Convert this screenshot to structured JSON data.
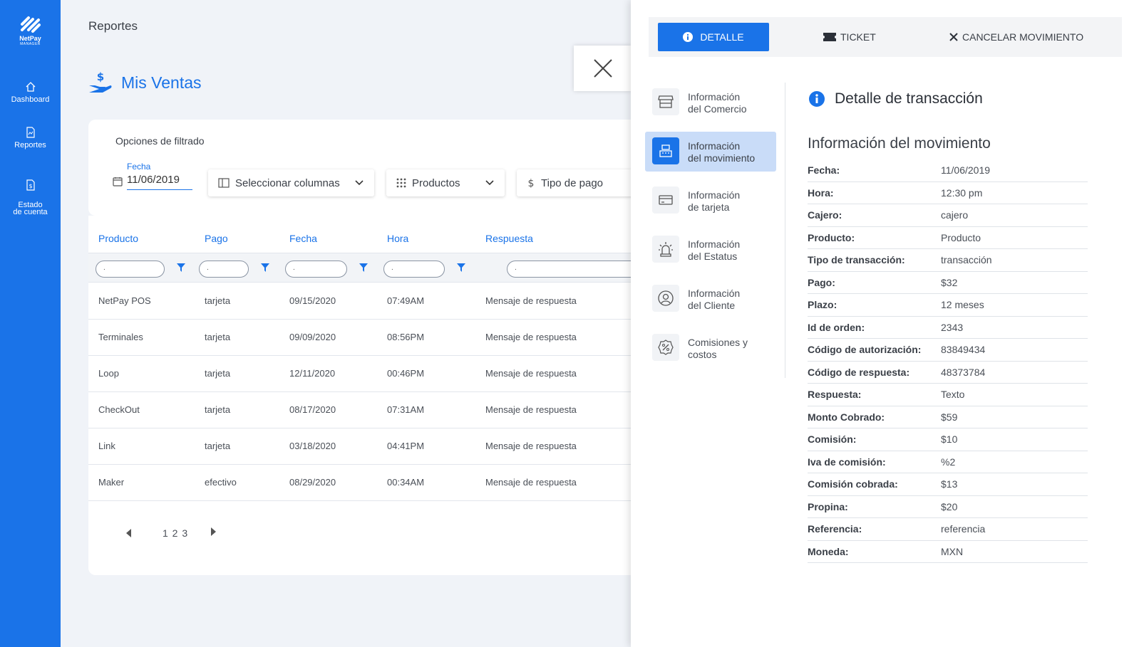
{
  "app": {
    "logo_name": "NetPay",
    "logo_sub": "MANAGER",
    "page_title": "Reportes"
  },
  "sidebar": {
    "items": [
      {
        "label": "Dashboard",
        "icon": "home-icon"
      },
      {
        "label": "Reportes",
        "icon": "report-icon"
      },
      {
        "label": "Estado\nde cuenta",
        "icon": "statement-icon"
      }
    ]
  },
  "main": {
    "heading": "Mis Ventas",
    "filters": {
      "label": "Opciones de filtrado",
      "date_label": "Fecha",
      "date_value": "11/06/2019",
      "columns_select": "Seleccionar columnas",
      "products_select": "Productos",
      "payment_select": "Tipo de pago"
    },
    "table": {
      "headers": [
        "Producto",
        "Pago",
        "Fecha",
        "Hora",
        "Respuesta"
      ],
      "filter_placeholder": ".",
      "rows": [
        [
          "NetPay POS",
          "tarjeta",
          "09/15/2020",
          "07:49AM",
          "Mensaje de respuesta"
        ],
        [
          "Terminales",
          "tarjeta",
          "09/09/2020",
          "08:56PM",
          "Mensaje de respuesta"
        ],
        [
          "Loop",
          "tarjeta",
          "12/11/2020",
          "00:46PM",
          "Mensaje de respuesta"
        ],
        [
          "CheckOut",
          "tarjeta",
          "08/17/2020",
          "07:31AM",
          "Mensaje de respuesta"
        ],
        [
          "Link",
          "tarjeta",
          "03/18/2020",
          "04:41PM",
          "Mensaje de respuesta"
        ],
        [
          "Maker",
          "efectivo",
          "08/29/2020",
          "00:34AM",
          "Mensaje de respuesta"
        ]
      ]
    },
    "pagination": {
      "pages": "1 2 3"
    }
  },
  "panel": {
    "tabs": [
      {
        "label": "DETALLE",
        "icon": "info-icon",
        "active": true
      },
      {
        "label": "TICKET",
        "icon": "ticket-icon",
        "active": false
      },
      {
        "label": "CANCELAR MOVIMIENTO",
        "icon": "close-icon",
        "active": false
      }
    ],
    "menu": [
      {
        "label": "Información\ndel Comercio",
        "icon": "store-icon",
        "active": false
      },
      {
        "label": "Información\ndel movimiento",
        "icon": "register-icon",
        "active": true
      },
      {
        "label": "Información\nde tarjeta",
        "icon": "card-icon",
        "active": false
      },
      {
        "label": "Información\ndel Estatus",
        "icon": "alarm-icon",
        "active": false
      },
      {
        "label": "Información\ndel Cliente",
        "icon": "user-icon",
        "active": false
      },
      {
        "label": "Comisiones y\ncostos",
        "icon": "percent-badge-icon",
        "active": false
      }
    ],
    "detail_title": "Detalle de transacción",
    "section_title": "Información del movimiento",
    "fields": [
      {
        "k": "Fecha:",
        "v": "11/06/2019"
      },
      {
        "k": "Hora:",
        "v": "12:30 pm"
      },
      {
        "k": "Cajero:",
        "v": "cajero"
      },
      {
        "k": "Producto:",
        "v": "Producto"
      },
      {
        "k": "Tipo de transacción:",
        "v": "transacción"
      },
      {
        "k": "Pago:",
        "v": "$32"
      },
      {
        "k": "Plazo:",
        "v": "12 meses"
      },
      {
        "k": "Id de orden:",
        "v": "2343"
      },
      {
        "k": "Código de autorización:",
        "v": "83849434"
      },
      {
        "k": "Código de respuesta:",
        "v": "48373784"
      },
      {
        "k": "Respuesta:",
        "v": "Texto"
      },
      {
        "k": "Monto Cobrado:",
        "v": "$59"
      },
      {
        "k": "Comisión:",
        "v": "$10"
      },
      {
        "k": "Iva de comisión:",
        "v": "%2"
      },
      {
        "k": "Comisión cobrada:",
        "v": "$13"
      },
      {
        "k": "Propina:",
        "v": "$20"
      },
      {
        "k": "Referencia:",
        "v": "referencia"
      },
      {
        "k": "Moneda:",
        "v": "MXN"
      }
    ]
  },
  "colors": {
    "primary": "#1a73e8",
    "active_bg": "#c9dcf8"
  }
}
